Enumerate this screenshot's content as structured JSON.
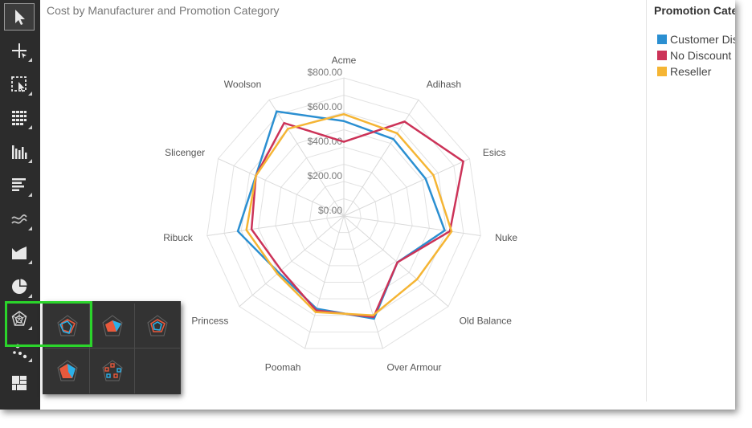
{
  "chart_data": {
    "type": "radar",
    "title": "Cost by Manufacturer and Promotion Category",
    "categories": [
      "Acme",
      "Adihash",
      "Esics",
      "Nuke",
      "Old Balance",
      "Over Armour",
      "Poomah",
      "Princess",
      "Ribuck",
      "Slicenger",
      "Woolson"
    ],
    "radial_ticks": [
      "$0.00",
      "$200.00",
      "$400.00",
      "$600.00",
      "$800.00"
    ],
    "rlim": [
      0,
      800
    ],
    "grid": true,
    "legend_title": "Promotion Category",
    "legend_position": "right",
    "series": [
      {
        "name": "Customer Discount",
        "color": "#2b8fd1",
        "values": [
          550,
          530,
          520,
          590,
          410,
          620,
          560,
          500,
          620,
          560,
          720
        ]
      },
      {
        "name": "No Discount",
        "color": "#cc3358",
        "values": [
          430,
          650,
          760,
          620,
          410,
          610,
          570,
          480,
          540,
          560,
          640
        ]
      },
      {
        "name": "Reseller",
        "color": "#f5b534",
        "values": [
          590,
          570,
          570,
          630,
          560,
          600,
          580,
          510,
          570,
          560,
          600
        ]
      }
    ]
  },
  "legend": {
    "title": "Promotion Category",
    "items": [
      {
        "label": "Customer Discount",
        "color": "#2b8fd1"
      },
      {
        "label": "No Discount",
        "color": "#cc3358"
      },
      {
        "label": "Reseller",
        "color": "#f5b534"
      }
    ]
  },
  "toolbar": {
    "tools": [
      {
        "icon": "pointer-icon"
      },
      {
        "icon": "add-crosshair-icon"
      },
      {
        "icon": "marquee-select-icon"
      },
      {
        "icon": "table-grid-icon"
      },
      {
        "icon": "column-chart-icon"
      },
      {
        "icon": "bar-chart-icon"
      },
      {
        "icon": "line-chart-icon"
      },
      {
        "icon": "area-chart-icon"
      },
      {
        "icon": "pie-chart-icon"
      },
      {
        "icon": "radar-chart-icon"
      },
      {
        "icon": "scatter-chart-icon"
      },
      {
        "icon": "treemap-icon"
      }
    ]
  },
  "flyout": {
    "options": [
      {
        "icon": "radar-line-chart-icon"
      },
      {
        "icon": "radar-filled-chart-icon"
      },
      {
        "icon": "radar-line-alt-chart-icon"
      },
      {
        "icon": "radar-filled-alt-chart-icon"
      },
      {
        "icon": "radar-point-chart-icon"
      }
    ]
  }
}
